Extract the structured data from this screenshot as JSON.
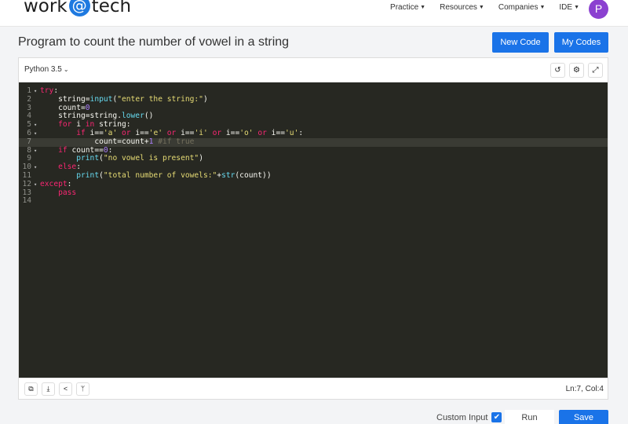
{
  "brand": {
    "left": "work",
    "at": "@",
    "right": "tech"
  },
  "nav": [
    {
      "label": "Practice",
      "icon": "caret-down-icon"
    },
    {
      "label": "Resources",
      "icon": "caret-down-icon"
    },
    {
      "label": "Companies",
      "icon": "caret-down-icon"
    },
    {
      "label": "IDE",
      "icon": "caret-down-icon"
    }
  ],
  "user": {
    "initial": "P",
    "color": "#8b41d0"
  },
  "page": {
    "title": "Program to count the number of vowel in a string"
  },
  "buttons": {
    "new_code": "New Code",
    "my_codes": "My Codes",
    "run": "Run",
    "save": "Save"
  },
  "editor": {
    "language": "Python 3.5",
    "toolbar_icons": [
      "reset-icon",
      "settings-icon",
      "fullscreen-icon"
    ],
    "footer_icons": [
      "copy-icon",
      "download-icon",
      "share-icon",
      "fork-icon"
    ],
    "status": "Ln:7, Col:4",
    "active_line": 7,
    "lines": [
      {
        "n": "1",
        "fold": true,
        "indent": "",
        "tokens": [
          [
            "kw",
            "try"
          ],
          [
            "op",
            ":"
          ]
        ]
      },
      {
        "n": "2",
        "fold": false,
        "indent": "    ",
        "tokens": [
          [
            "op",
            "string="
          ],
          [
            "fn",
            "input"
          ],
          [
            "op",
            "("
          ],
          [
            "str",
            "\"enter the string:\""
          ],
          [
            "op",
            ")"
          ]
        ]
      },
      {
        "n": "3",
        "fold": false,
        "indent": "    ",
        "tokens": [
          [
            "op",
            "count="
          ],
          [
            "num",
            "0"
          ]
        ]
      },
      {
        "n": "4",
        "fold": false,
        "indent": "    ",
        "tokens": [
          [
            "op",
            "string=string."
          ],
          [
            "fn",
            "lower"
          ],
          [
            "op",
            "()"
          ]
        ]
      },
      {
        "n": "5",
        "fold": true,
        "indent": "    ",
        "tokens": [
          [
            "kw",
            "for"
          ],
          [
            "op",
            " i "
          ],
          [
            "kw",
            "in"
          ],
          [
            "op",
            " string:"
          ]
        ]
      },
      {
        "n": "6",
        "fold": true,
        "indent": "        ",
        "tokens": [
          [
            "kw",
            "if"
          ],
          [
            "op",
            " i=="
          ],
          [
            "str",
            "'a'"
          ],
          [
            "op",
            " "
          ],
          [
            "kw",
            "or"
          ],
          [
            "op",
            " i=="
          ],
          [
            "str",
            "'e'"
          ],
          [
            "op",
            " "
          ],
          [
            "kw",
            "or"
          ],
          [
            "op",
            " i=="
          ],
          [
            "str",
            "'i'"
          ],
          [
            "op",
            " "
          ],
          [
            "kw",
            "or"
          ],
          [
            "op",
            " i=="
          ],
          [
            "str",
            "'o'"
          ],
          [
            "op",
            " "
          ],
          [
            "kw",
            "or"
          ],
          [
            "op",
            " i=="
          ],
          [
            "str",
            "'u'"
          ],
          [
            "op",
            ":"
          ]
        ]
      },
      {
        "n": "7",
        "fold": false,
        "indent": "            ",
        "tokens": [
          [
            "op",
            "count=count+"
          ],
          [
            "num",
            "1"
          ],
          [
            "op",
            " "
          ],
          [
            "cm",
            "#if true"
          ]
        ]
      },
      {
        "n": "8",
        "fold": true,
        "indent": "    ",
        "tokens": [
          [
            "kw",
            "if"
          ],
          [
            "op",
            " count=="
          ],
          [
            "num",
            "0"
          ],
          [
            "op",
            ":"
          ]
        ]
      },
      {
        "n": "9",
        "fold": false,
        "indent": "        ",
        "tokens": [
          [
            "fn",
            "print"
          ],
          [
            "op",
            "("
          ],
          [
            "str",
            "\"no vowel is present\""
          ],
          [
            "op",
            ")"
          ]
        ]
      },
      {
        "n": "10",
        "fold": true,
        "indent": "    ",
        "tokens": [
          [
            "kw",
            "else"
          ],
          [
            "op",
            ":"
          ]
        ]
      },
      {
        "n": "11",
        "fold": false,
        "indent": "        ",
        "tokens": [
          [
            "fn",
            "print"
          ],
          [
            "op",
            "("
          ],
          [
            "str",
            "\"total number of vowels:\""
          ],
          [
            "op",
            "+"
          ],
          [
            "fn",
            "str"
          ],
          [
            "op",
            "(count))"
          ]
        ]
      },
      {
        "n": "12",
        "fold": true,
        "indent": "",
        "tokens": [
          [
            "kw",
            "except"
          ],
          [
            "op",
            ":"
          ]
        ]
      },
      {
        "n": "13",
        "fold": false,
        "indent": "    ",
        "tokens": [
          [
            "kw",
            "pass"
          ]
        ]
      },
      {
        "n": "14",
        "fold": false,
        "indent": "",
        "tokens": []
      }
    ]
  },
  "custom_input": {
    "label": "Custom Input",
    "checked": true
  }
}
